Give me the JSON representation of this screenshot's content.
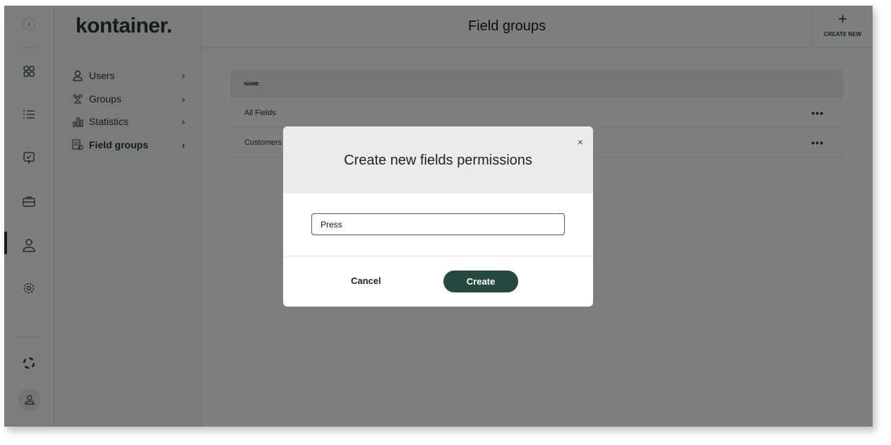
{
  "brand": "kontainer.",
  "nav": {
    "items": [
      {
        "label": "Users",
        "icon": "user-icon"
      },
      {
        "label": "Groups",
        "icon": "users-icon"
      },
      {
        "label": "Statistics",
        "icon": "bar-chart-icon"
      },
      {
        "label": "Field groups",
        "icon": "field-groups-icon",
        "active": true
      }
    ]
  },
  "header": {
    "title": "Field groups",
    "create_new": "CREATE NEW"
  },
  "table": {
    "column": "NAME",
    "rows": [
      "All Fields",
      "Customers"
    ]
  },
  "modal": {
    "title": "Create new fields permissions",
    "input_value": "Press",
    "cancel": "Cancel",
    "create": "Create",
    "close": "×"
  },
  "colors": {
    "accent": "#264a3f",
    "overlay": "rgba(0,0,0,0.5)"
  }
}
